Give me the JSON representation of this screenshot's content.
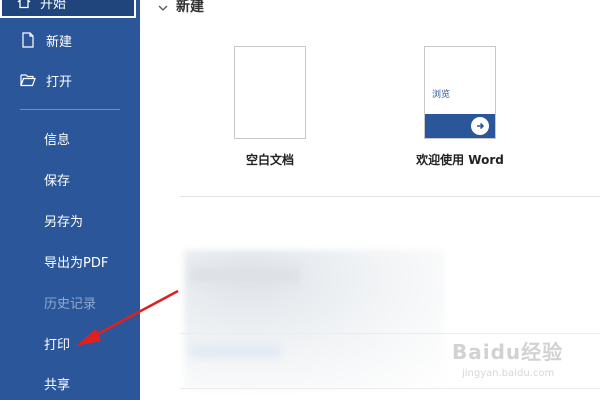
{
  "sidebar": {
    "selected_label": "开始",
    "items": [
      {
        "label": "新建",
        "icon": "new-document-icon"
      },
      {
        "label": "打开",
        "icon": "open-folder-icon"
      },
      {
        "label": "信息"
      },
      {
        "label": "保存"
      },
      {
        "label": "另存为"
      },
      {
        "label": "导出为PDF"
      },
      {
        "label": "历史记录",
        "disabled": true
      },
      {
        "label": "打印"
      },
      {
        "label": "共享"
      }
    ]
  },
  "main": {
    "section_title": "新建",
    "templates": [
      {
        "label": "空白文档"
      },
      {
        "label": "欢迎使用 Word",
        "thumb_text": "浏览"
      }
    ]
  },
  "watermark": {
    "text": "Baidu经验",
    "url": "jingyan.baidu.com"
  },
  "colors": {
    "sidebar_bg": "#2b579a",
    "annotation_arrow": "#e02020"
  }
}
